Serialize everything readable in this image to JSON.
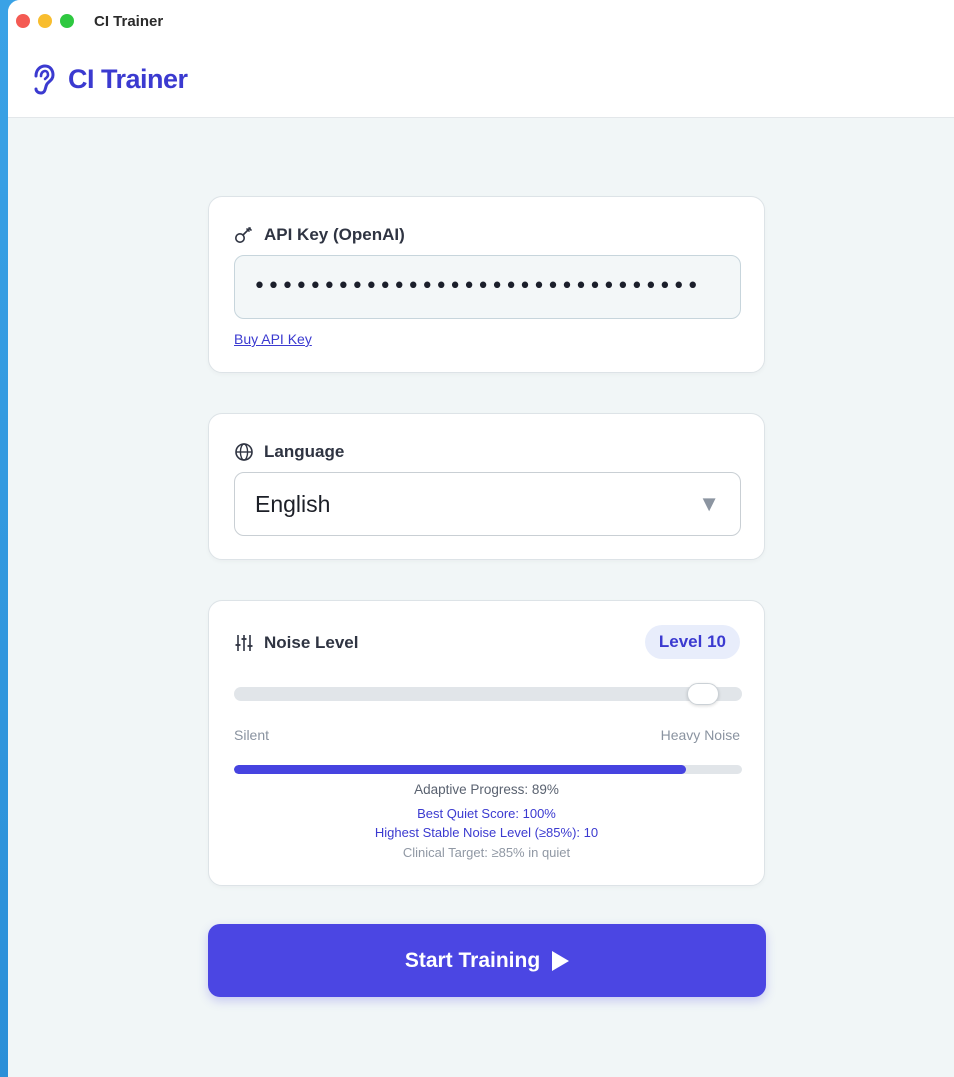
{
  "window": {
    "title": "CI Trainer"
  },
  "app": {
    "brand": "CI Trainer",
    "accent": "#3b3ad0"
  },
  "api_key": {
    "label": "API Key (OpenAI)",
    "value": "••••••••••••••••••••••••••••••••",
    "buy_link": "Buy API Key"
  },
  "language": {
    "label": "Language",
    "selected": "English",
    "caret": "▼"
  },
  "noise": {
    "label": "Noise Level",
    "badge": "Level 10",
    "slider_fraction": 1.0,
    "min_label": "Silent",
    "max_label": "Heavy Noise",
    "progress_fraction": 0.89,
    "adaptive_progress": "Adaptive Progress: 89%",
    "best_quiet": "Best Quiet Score: 100%",
    "highest_stable": "Highest Stable Noise Level (≥85%): 10",
    "clinical_target": "Clinical Target: ≥85% in quiet"
  },
  "start_button": {
    "label": "Start Training"
  },
  "colors": {
    "primary": "#4b46e3",
    "background": "#f1f6f7",
    "muted": "#8a93a0"
  }
}
